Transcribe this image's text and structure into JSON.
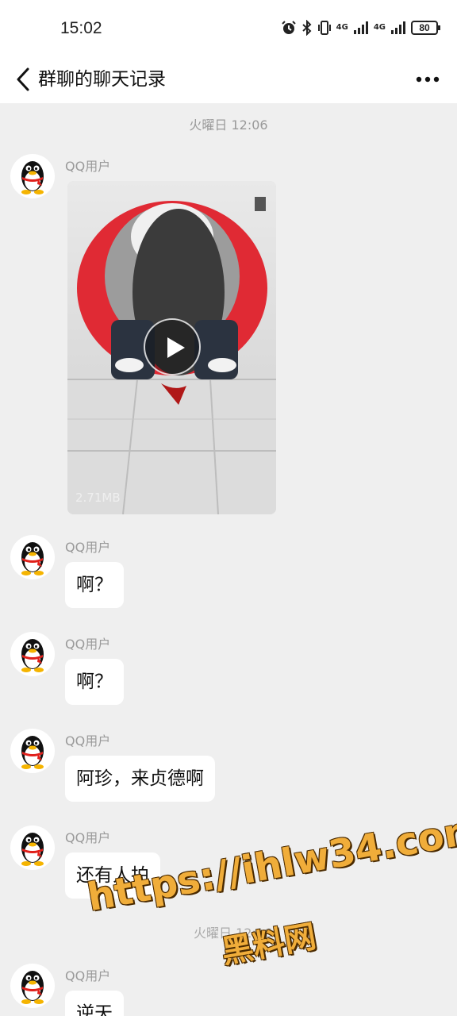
{
  "status_bar": {
    "time": "15:02",
    "network_1": "4G",
    "network_2": "4G",
    "battery": "80",
    "icons": [
      "alarm-icon",
      "bluetooth-icon",
      "vibrate-icon",
      "signal-icon",
      "signal-icon",
      "battery-icon"
    ]
  },
  "nav": {
    "title": "群聊的聊天记录",
    "back_icon": "back-chevron-icon",
    "more_icon": "more-dots-icon"
  },
  "chat": {
    "time_divider": "火曜日 12:06",
    "video_message": {
      "sender": "QQ用户",
      "file_size": "2.71MB"
    },
    "messages": [
      {
        "sender": "QQ用户",
        "text": "啊？"
      },
      {
        "sender": "QQ用户",
        "text": "啊？"
      },
      {
        "sender": "QQ用户",
        "text": "阿珍，来贞德啊"
      },
      {
        "sender": "QQ用户",
        "text": "还有人拍"
      },
      {
        "sender": "QQ用户",
        "text": "逆天"
      }
    ],
    "faded_time": "火曜日 12:16"
  },
  "watermark": {
    "url": "https://ihlw34.com",
    "name": "黑料网",
    "color": "#f0ad3a"
  }
}
